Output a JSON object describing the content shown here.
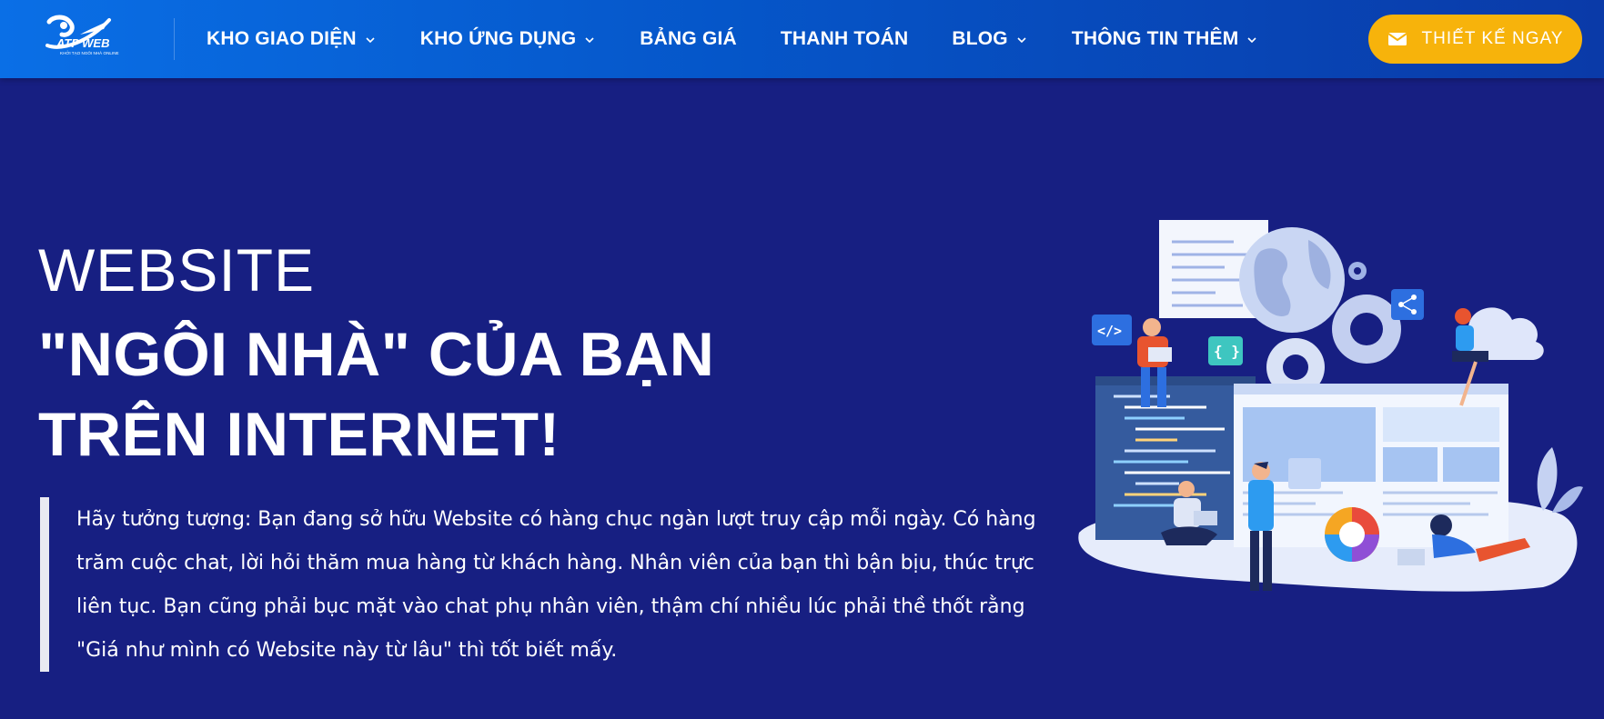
{
  "header": {
    "logo_text": "ATP WEB",
    "logo_tagline": "KHỞI TẠO NGÔI NHÀ ONLINE",
    "nav": [
      {
        "label": "KHO GIAO DIỆN",
        "has_dropdown": true
      },
      {
        "label": "KHO ỨNG DỤNG",
        "has_dropdown": true
      },
      {
        "label": "BẢNG GIÁ",
        "has_dropdown": false
      },
      {
        "label": "THANH TOÁN",
        "has_dropdown": false
      },
      {
        "label": "BLOG",
        "has_dropdown": true
      },
      {
        "label": "THÔNG TIN THÊM",
        "has_dropdown": true
      }
    ],
    "cta_label": "THIẾT KẾ NGAY",
    "cta_icon": "envelope-icon"
  },
  "hero": {
    "kicker": "WEBSITE",
    "title": "\"NGÔI NHÀ\" CỦA BẠN TRÊN INTERNET!",
    "quote": "Hãy tưởng tượng: Bạn đang sở hữu Website có hàng chục ngàn lượt truy cập mỗi ngày. Có hàng trăm cuộc chat, lời hỏi thăm mua hàng từ khách hàng. Nhân viên của bạn thì bận bịu, thúc trực liên tục. Bạn cũng phải bục mặt vào chat phụ nhân viên, thậm chí nhiều lúc phải thề thốt rằng \"Giá như mình có Website này từ lâu\" thì tốt biết mấy."
  },
  "illustration": {
    "code_tag": "</>",
    "braces_tag": "{ }"
  },
  "colors": {
    "background": "#171f82",
    "header_start": "#0a6fe6",
    "header_end": "#0a3aa8",
    "cta": "#f7b30b"
  }
}
